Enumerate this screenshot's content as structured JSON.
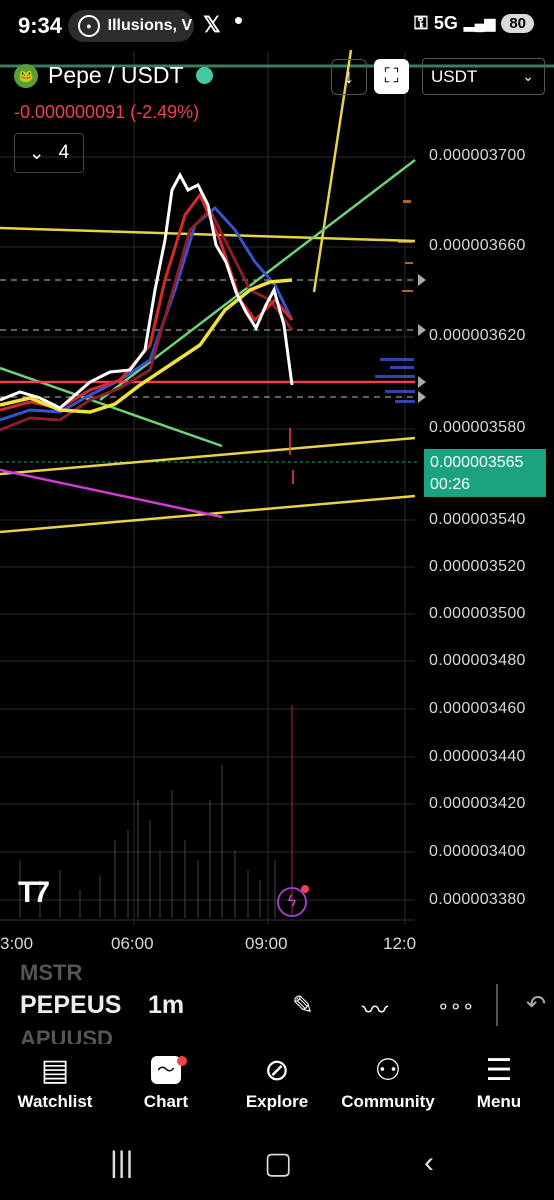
{
  "status_bar": {
    "time": "9:34",
    "notification_text": "Illusions, V",
    "network": "5G",
    "battery": "80",
    "icons": [
      "ring-icon",
      "x-app-icon",
      "key-icon",
      "signal-icon"
    ]
  },
  "chart_header": {
    "pair": "Pepe / USDT",
    "change": "-0.000000091 (-2.49%)",
    "indicator_count": "4",
    "currency": "USDT",
    "colors": {
      "down": "#f0424b",
      "live": "#45c9a3",
      "current_price_bg": "#1ba37f"
    }
  },
  "price_axis": [
    "0.000003700",
    "0.000003660",
    "0.000003620",
    "0.000003580",
    "0.000003540",
    "0.000003520",
    "0.000003500",
    "0.000003480",
    "0.000003460",
    "0.000003440",
    "0.000003420",
    "0.000003400",
    "0.000003380"
  ],
  "current_price": {
    "value": "0.000003565",
    "countdown": "00:26"
  },
  "time_axis": [
    "3:00",
    "06:00",
    "09:00",
    "12:0"
  ],
  "toolbar": {
    "symbol_prev": "MSTR",
    "symbol": "PEPEUS",
    "symbol_next": "APUUSD",
    "interval": "1m"
  },
  "tabs": [
    {
      "label": "Watchlist",
      "icon": "book-icon"
    },
    {
      "label": "Chart",
      "icon": "chart-icon"
    },
    {
      "label": "Explore",
      "icon": "compass-icon"
    },
    {
      "label": "Community",
      "icon": "people-icon"
    },
    {
      "label": "Menu",
      "icon": "menu-icon"
    }
  ]
}
